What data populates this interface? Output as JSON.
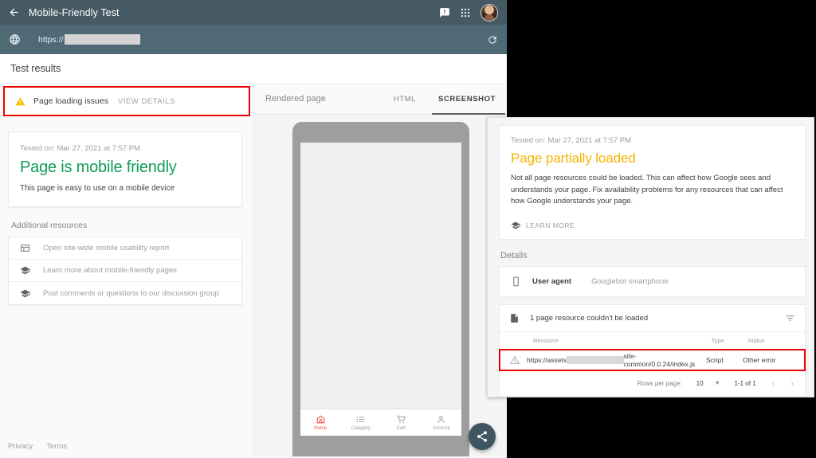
{
  "window": {
    "header": {
      "back_icon": "arrow-back-icon",
      "title": "Mobile-Friendly Test",
      "feedback_icon": "feedback-icon",
      "apps_icon": "apps-grid-icon",
      "avatar_icon": "user-avatar"
    },
    "urlbar": {
      "globe_icon": "globe-icon",
      "url_prefix": "https://",
      "url_redacted": true,
      "reload_icon": "reload-icon"
    },
    "results_title": "Test results"
  },
  "left": {
    "issues_banner": {
      "warning_icon": "warning-triangle-icon",
      "label": "Page loading issues",
      "action": "VIEW DETAILS"
    },
    "status_card": {
      "tested_on": "Tested on: Mar 27, 2021 at 7:57 PM",
      "verdict": "Page is mobile friendly",
      "verdict_color": "#0f9d58",
      "subtitle": "This page is easy to use on a mobile device"
    },
    "additional_resources_label": "Additional resources",
    "resources": [
      {
        "icon": "report-icon",
        "label": "Open site-wide mobile usability report"
      },
      {
        "icon": "graduation-cap-icon",
        "label": "Learn more about mobile-friendly pages"
      },
      {
        "icon": "graduation-cap-icon",
        "label": "Post comments or questions to our discussion group"
      }
    ],
    "footer": {
      "privacy": "Privacy",
      "terms": "Terms"
    }
  },
  "right": {
    "tabs_title": "Rendered page",
    "tabs": [
      {
        "label": "HTML",
        "active": false
      },
      {
        "label": "SCREENSHOT",
        "active": true
      }
    ],
    "phone_nav": [
      {
        "icon": "home-icon",
        "label": "Home",
        "active": true
      },
      {
        "icon": "list-icon",
        "label": "Category",
        "active": false
      },
      {
        "icon": "cart-icon",
        "label": "Cart",
        "active": false
      },
      {
        "icon": "account-icon",
        "label": "Account",
        "active": false
      }
    ],
    "share_fab_icon": "share-icon",
    "active_nav_color": "#ef5350"
  },
  "panel": {
    "tested_on": "Tested on: Mar 27, 2021 at 7:57 PM",
    "verdict": "Page partially loaded",
    "verdict_color": "#f5b400",
    "description": "Not all page resources could be loaded. This can affect how Google sees and understands your page. Fix availability problems for any resources that can affect how Google understands your page.",
    "learn_more": "LEARN MORE",
    "learn_more_icon": "graduation-cap-icon",
    "details_label": "Details",
    "user_agent": {
      "icon": "smartphone-icon",
      "key": "User agent",
      "value": "Googlebot smartphone"
    },
    "resource_section": {
      "icon": "document-icon",
      "title": "1 page resource couldn't be loaded",
      "filter_icon": "filter-icon",
      "columns": [
        "Resource",
        "Type",
        "Status"
      ],
      "rows": [
        {
          "icon": "warning-outline-icon",
          "resource_prefix": "https://assets",
          "resource_redacted": true,
          "resource_suffix": "site-common/0.0.24/index.js",
          "type": "Script",
          "status": "Other error"
        }
      ],
      "pagination": {
        "rows_per_page_label": "Rows per page:",
        "rows_per_page_value": "10",
        "range": "1-1 of 1",
        "prev_icon": "chevron-left-icon",
        "next_icon": "chevron-right-icon"
      }
    },
    "highlight_color": "#ee0000"
  }
}
